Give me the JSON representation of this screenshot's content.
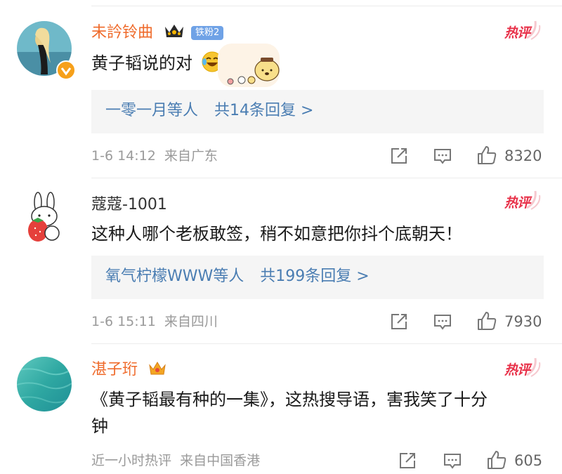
{
  "comments": [
    {
      "username": "未訡铃曲",
      "fan_badge": "铁粉2",
      "hot_label": "热评",
      "text": "黄子韬说的对",
      "reply_users": "一零一月等人",
      "reply_count": "共14条回复 >",
      "time": "1-6 14:12",
      "location": "来自广东",
      "likes": "8320"
    },
    {
      "username": "蔻蔻-1001",
      "hot_label": "热评",
      "text": "这种人哪个老板敢签，稍不如意把你抖个底朝天！",
      "reply_users": "氧气柠檬WWW等人",
      "reply_count": "共199条回复 >",
      "time": "1-6 15:11",
      "location": "来自四川",
      "likes": "7930"
    },
    {
      "username": "湛子珩",
      "hot_label": "热评",
      "text_line1": "《黄子韬最有种的一集》，这热搜导语，害我笑了十分",
      "text_line2": "钟",
      "time": "近一小时热评",
      "location": "来自中国香港",
      "likes": "605"
    }
  ],
  "colors": {
    "username_orange": "#ef6a2a",
    "reply_link": "#4a7db2",
    "hot_red": "#e8324a",
    "meta_gray": "#9a9a9a"
  },
  "icons": [
    "verified-badge-icon",
    "crown-icon",
    "laugh-cry-emoji-icon",
    "share-icon",
    "comment-icon",
    "like-icon"
  ]
}
